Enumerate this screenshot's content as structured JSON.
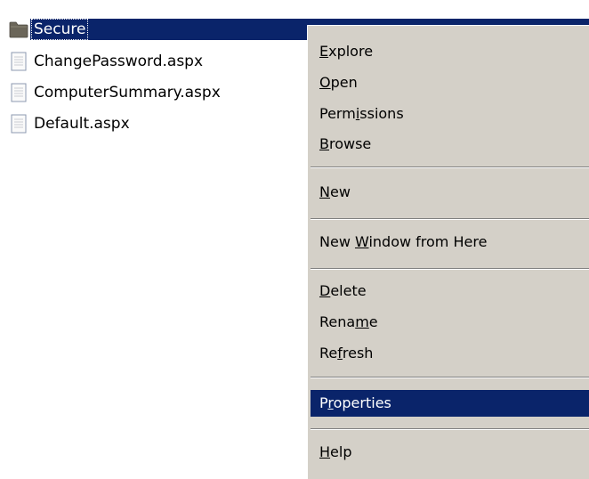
{
  "tree": {
    "items": [
      {
        "label": "Secure",
        "icon": "folder-icon",
        "selected": true
      },
      {
        "label": "ChangePassword.aspx",
        "icon": "document-icon",
        "selected": false
      },
      {
        "label": "ComputerSummary.aspx",
        "icon": "document-icon",
        "selected": false
      },
      {
        "label": "Default.aspx",
        "icon": "document-icon",
        "selected": false
      }
    ]
  },
  "context_menu": {
    "items": [
      {
        "pre": "",
        "key": "E",
        "post": "xplore"
      },
      {
        "pre": "",
        "key": "O",
        "post": "pen"
      },
      {
        "pre": "Perm",
        "key": "i",
        "post": "ssions"
      },
      {
        "pre": "",
        "key": "B",
        "post": "rowse"
      },
      {
        "pre": "",
        "key": "N",
        "post": "ew",
        "has_submenu": true
      },
      {
        "pre": "New ",
        "key": "W",
        "post": "indow from Here"
      },
      {
        "pre": "",
        "key": "D",
        "post": "elete"
      },
      {
        "pre": "Rena",
        "key": "m",
        "post": "e"
      },
      {
        "pre": "Re",
        "key": "f",
        "post": "resh"
      },
      {
        "pre": "P",
        "key": "r",
        "post": "operties",
        "highlighted": true
      },
      {
        "pre": "",
        "key": "H",
        "post": "elp"
      }
    ]
  },
  "colors": {
    "selection": "#0a246a",
    "menu_background": "#d4d0c8",
    "folder": "#6b6659",
    "document_border": "#8c99b0"
  }
}
